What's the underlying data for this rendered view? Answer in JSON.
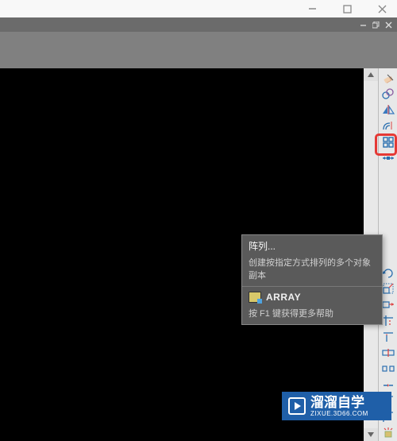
{
  "titlebar": {
    "minimize": "—",
    "maximize": "□",
    "close": "×"
  },
  "window_chrome": {
    "minimize": "—",
    "restore": "❐",
    "close": "×"
  },
  "toolbar": {
    "items": [
      {
        "name": "erase-tool"
      },
      {
        "name": "copy-tool"
      },
      {
        "name": "mirror-tool"
      },
      {
        "name": "offset-tool"
      },
      {
        "name": "array-tool"
      },
      {
        "name": "move-tool"
      }
    ],
    "lower_items": [
      {
        "name": "rotate-tool"
      },
      {
        "name": "scale-tool"
      },
      {
        "name": "stretch-tool"
      },
      {
        "name": "trim-tool"
      },
      {
        "name": "extend-tool"
      },
      {
        "name": "break-tool"
      },
      {
        "name": "join-tool"
      },
      {
        "name": "chamfer-tool"
      },
      {
        "name": "fillet-tool"
      },
      {
        "name": "explode-tool"
      }
    ]
  },
  "tooltip": {
    "title": "阵列...",
    "description": "创建按指定方式排列的多个对象副本",
    "command": "ARRAY",
    "help": "按 F1 键获得更多帮助"
  },
  "watermark": {
    "brand": "溜溜自学",
    "url": "ZIXUE.3D66.COM"
  }
}
